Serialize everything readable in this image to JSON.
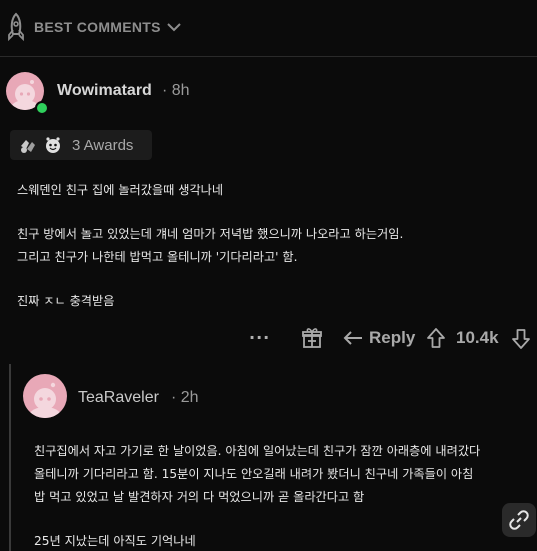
{
  "header": {
    "section_label": "BEST COMMENTS"
  },
  "comment": {
    "username": "Wowimatard",
    "time": "· 8h",
    "awards_label": "3 Awards",
    "lines": [
      "스웨덴인 친구 집에 놀러갔을때 생각나네",
      "친구 방에서 놀고 있었는데 걔네 엄마가 저녁밥 했으니까 나오라고 하는거임.",
      "그리고 친구가 나한테 밥먹고 올테니까 '기다리라고' 함.",
      "진짜 ㅈㄴ 충격받음"
    ],
    "actions": {
      "more": "···",
      "reply_label": "Reply",
      "score": "10.4k"
    }
  },
  "reply": {
    "username": "TeaRaveler",
    "time": "· 2h",
    "lines": [
      "친구집에서 자고 가기로 한 날이었음. 아침에 일어났는데 친구가 잠깐 아래층에 내려갔다",
      "올테니까 기다리라고 함. 15분이 지나도 안오길래 내려가 봤더니 친구네 가족들이 아침",
      "밥 먹고 있었고 날 발견하자 거의 다 먹었으니까 곧 올라간다고 함",
      "25년 지났는데 아직도 기억나네"
    ]
  },
  "icons": {
    "header": "rocket-icon",
    "chevron": "chevron-down-icon",
    "gift": "gift-icon",
    "reply": "reply-arrow-icon",
    "upvote": "upvote-icon",
    "downvote": "downvote-icon",
    "link": "link-icon"
  },
  "colors": {
    "background": "#0b0b0b",
    "avatar": "#e8a8b7",
    "online": "#2fd05c"
  }
}
